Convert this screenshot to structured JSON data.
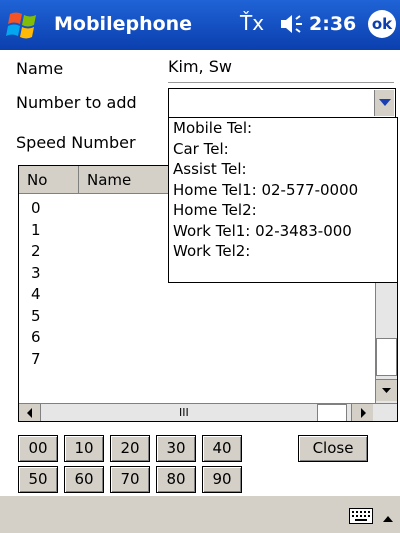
{
  "titlebar": {
    "app_title": "Mobilephone",
    "signal_text": "Ťx",
    "time": "2:36",
    "ok_label": "ok"
  },
  "form": {
    "name_label": "Name",
    "name_value": "Kim, Sw",
    "number_label": "Number to add",
    "speed_label": "Speed Number"
  },
  "dropdown": {
    "items": [
      "Mobile Tel:",
      "Car Tel:",
      "Assist Tel:",
      "Home Tel1: 02-577-0000",
      "Home Tel2:",
      "Work Tel1: 02-3483-000",
      "Work Tel2:"
    ]
  },
  "list": {
    "columns": [
      "No",
      "Name"
    ],
    "rows": [
      "0",
      "1",
      "2",
      "3",
      "4",
      "5",
      "6",
      "7"
    ],
    "hscroll_grip": "III"
  },
  "buttons": {
    "row1": [
      "00",
      "10",
      "20",
      "30",
      "40"
    ],
    "row2": [
      "50",
      "60",
      "70",
      "80",
      "90"
    ],
    "close": "Close"
  },
  "colors": {
    "titlebar": "#0b3fae",
    "chrome": "#d4d0c8"
  },
  "icons": [
    "windows-start-icon",
    "volume-icon",
    "ok-icon",
    "keyboard-icon",
    "chevron-up-icon",
    "chevron-down-icon"
  ]
}
